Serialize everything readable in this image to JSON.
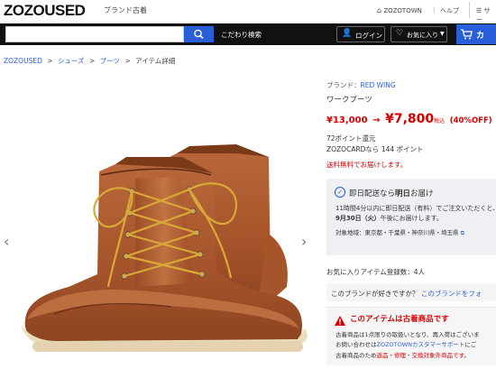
{
  "header": {
    "logo": "ZOZOUSED",
    "logo_sub": "ブランド古着",
    "zozotown_link": "ZOZOTOWN",
    "help_link": "ヘルプ",
    "side_link": "サー"
  },
  "navbar": {
    "search_placeholder": "",
    "advanced_search": "こだわり検索",
    "login": "ログイン",
    "favorites": "お気に入り",
    "cart": "カ"
  },
  "breadcrumb": {
    "items": [
      "ZOZOUSED",
      "シューズ",
      "ブーツ",
      "アイテム詳細"
    ],
    "sep": ">"
  },
  "product": {
    "brand_label": "ブランド：",
    "brand_name": "RED WING",
    "name": "ワークブーツ",
    "price_original": "¥13,000",
    "arrow": "→",
    "price_sale": "¥7,800",
    "tax_note": "税込",
    "discount": "(40%OFF)",
    "points_return": "72ポイント還元",
    "zozocard_points": "ZOZOCARDなら 144 ポイント",
    "free_shipping": "送料無料でお届けします。"
  },
  "delivery": {
    "title_prefix": "即日配送なら",
    "title_bold": "明日",
    "title_suffix": "お届け",
    "line1": "11時間4分以内に即日配送（有料）でご注文いただくと、",
    "line2_bold": "9月30日（火）",
    "line2_rest": "午後にお届けします。",
    "area": "対象地域：東京都・千葉県・神奈川県・埼玉県",
    "area_link": "対象地域"
  },
  "favorites_count": "お気に入りアイテム登録数：4人",
  "brand_prompt": {
    "text": "このブランドが好きですか？",
    "link": "このブランドをフォ"
  },
  "used_notice": {
    "title": "このアイテムは古着商品です",
    "line1": "古着商品は1点限りの取扱いとなり、再入荷はございま",
    "line2_pre": "お問い合わせは",
    "line2_link": "ZOZOTOWNカスタマーサポート",
    "line2_post": "にご",
    "line3_pre": "古着商品のため",
    "line3_red": "返品・修理・交換対象外商品です",
    "line3_post": "。"
  },
  "colors": {
    "accent_blue": "#2a5ed8",
    "price_red": "#d40000",
    "navbar_bg": "#111111"
  }
}
